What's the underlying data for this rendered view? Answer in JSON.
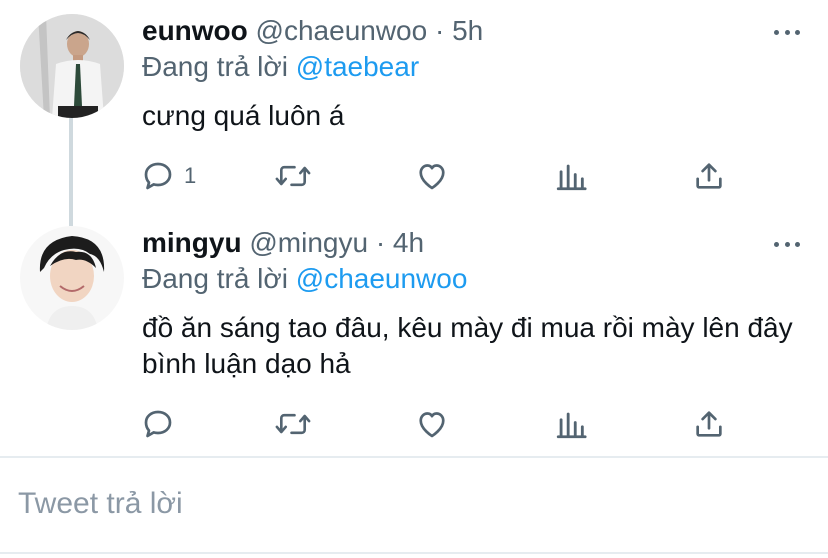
{
  "tweets": [
    {
      "name": "eunwoo",
      "handle": "@chaeunwoo",
      "dot": "·",
      "time": "5h",
      "replying_prefix": "Đang trả lời",
      "replying_to": "@taebear",
      "text": "cưng quá luôn á",
      "reply_count": "1"
    },
    {
      "name": "mingyu",
      "handle": "@mingyu",
      "dot": "·",
      "time": "4h",
      "replying_prefix": "Đang trả lời",
      "replying_to": "@chaeunwoo",
      "text": "đồ ăn sáng tao đâu, kêu mày đi mua rồi mày lên đây bình luận dạo hả",
      "reply_count": ""
    }
  ],
  "reply_box": {
    "placeholder": "Tweet trả lời"
  },
  "colors": {
    "accent": "#1d9bf0",
    "secondary_text": "#536471",
    "thread_line": "#cfd9de"
  },
  "icons": [
    "reply-icon",
    "retweet-icon",
    "like-icon",
    "analytics-icon",
    "share-icon",
    "more-icon"
  ]
}
